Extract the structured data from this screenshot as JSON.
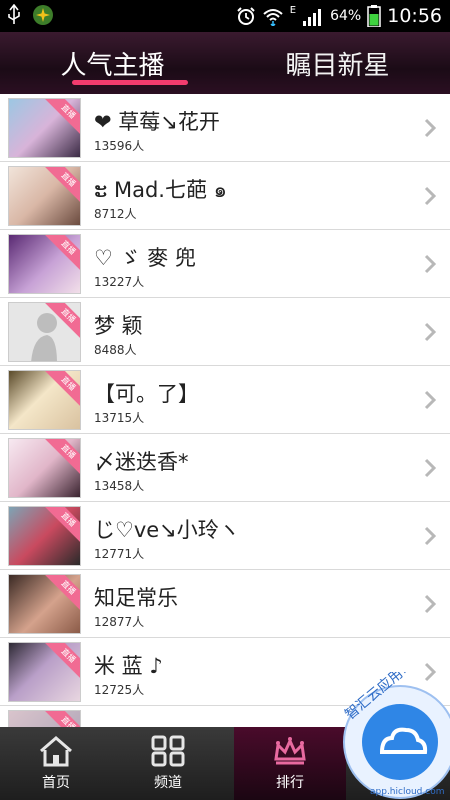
{
  "status_bar": {
    "battery": "64%",
    "time": "10:56",
    "network": "E",
    "icons": [
      "usb-icon",
      "app-icon",
      "alarm-icon",
      "wifi-icon",
      "signal-icon",
      "battery-icon"
    ]
  },
  "tabs": [
    {
      "label": "人气主播",
      "active": true
    },
    {
      "label": "瞩目新星",
      "active": false
    }
  ],
  "list": {
    "ribbon_text": "直播",
    "items": [
      {
        "name": "❤ 草莓↘花开",
        "count": "13596人"
      },
      {
        "name": "ະ Mad.七葩 ๑",
        "count": "8712人"
      },
      {
        "name": "♡ ゞ 麥 兜",
        "count": "13227人"
      },
      {
        "name": "梦 颖",
        "count": "8488人"
      },
      {
        "name": "【可。了】",
        "count": "13715人"
      },
      {
        "name": "〆迷迭香*",
        "count": "13458人"
      },
      {
        "name": "じ♡ve↘小玲ヽ",
        "count": "12771人"
      },
      {
        "name": "知足常乐",
        "count": "12877人"
      },
      {
        "name": "米 蓝 ♪",
        "count": "12725人"
      }
    ]
  },
  "bottom_nav": [
    {
      "label": "首页",
      "icon": "home-icon"
    },
    {
      "label": "频道",
      "icon": "grid-icon"
    },
    {
      "label": "排行",
      "icon": "crown-icon",
      "active": true
    }
  ],
  "watermark": {
    "text": "智汇云应用市场",
    "url": "app.hicloud.com"
  },
  "colors": {
    "accent": "#f23c6e",
    "ribbon": "#f16b93",
    "nav_bg": "#2a2a2a"
  }
}
